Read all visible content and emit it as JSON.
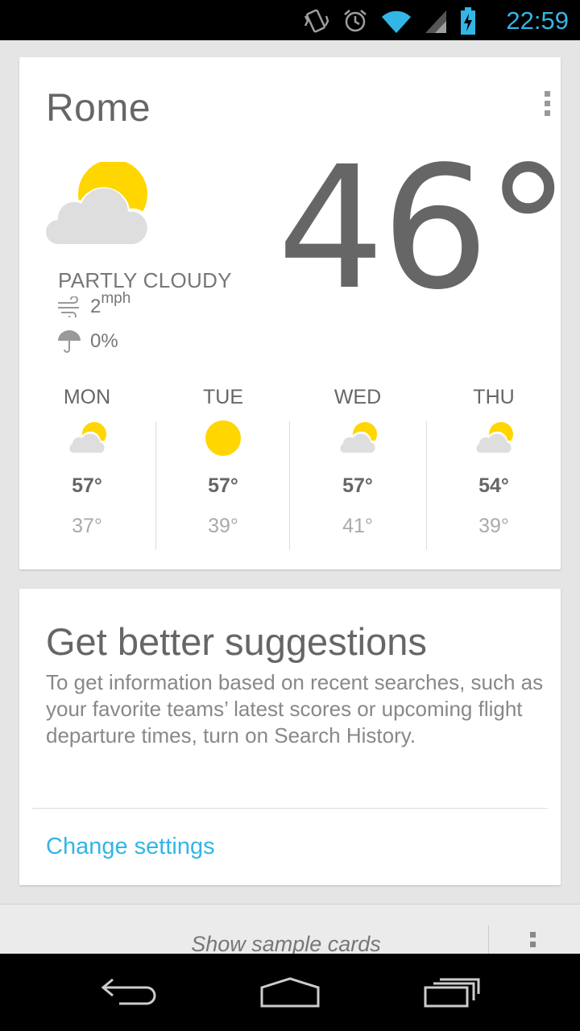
{
  "status_bar": {
    "time": "22:59",
    "icons": [
      "vibrate-icon",
      "alarm-icon",
      "wifi-icon",
      "signal-icon",
      "battery-charging-icon"
    ]
  },
  "weather": {
    "city": "Rome",
    "temperature": "46°",
    "condition": "PARTLY CLOUDY",
    "wind_value": "2",
    "wind_unit": "mph",
    "precipitation": "0%",
    "colors": {
      "sun": "#ffd600",
      "cloud": "#dedede",
      "text": "#666666"
    },
    "forecast": [
      {
        "day": "MON",
        "icon": "partly-cloudy-icon",
        "high": "57°",
        "low": "37°"
      },
      {
        "day": "TUE",
        "icon": "sunny-icon",
        "high": "57°",
        "low": "39°"
      },
      {
        "day": "WED",
        "icon": "partly-cloudy-icon",
        "high": "57°",
        "low": "41°"
      },
      {
        "day": "THU",
        "icon": "partly-cloudy-icon",
        "high": "54°",
        "low": "39°"
      }
    ]
  },
  "suggestions": {
    "title": "Get better suggestions",
    "body": "To get information based on recent searches, such as your favorite teams’ latest scores or upcoming flight departure times, turn on Search History.",
    "action": "Change settings",
    "accent": "#33b5e5"
  },
  "bottom": {
    "sample_cards": "Show sample cards"
  },
  "nav": [
    "back-icon",
    "home-icon",
    "recent-apps-icon"
  ]
}
